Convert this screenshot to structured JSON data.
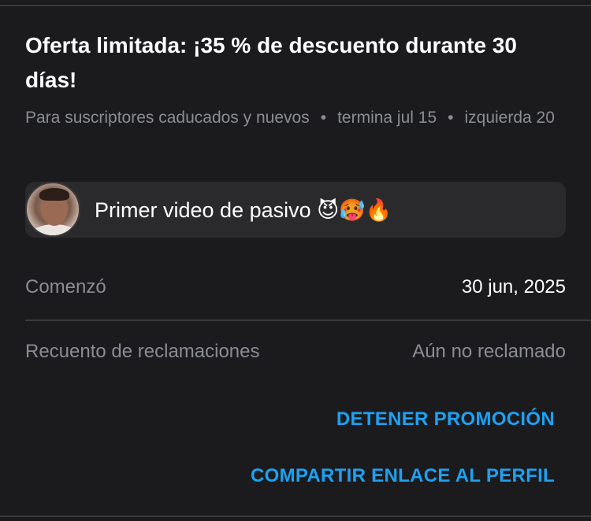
{
  "promo": {
    "title": "Oferta limitada: ¡35 % de descuento durante 30 días!",
    "audience": "Para suscriptores caducados y nuevos",
    "ends": "termina jul 15",
    "remaining": "izquierda 20",
    "separator": "•"
  },
  "message": {
    "text": "Primer video de pasivo 😈🥵🔥",
    "avatar_icon": "user-avatar"
  },
  "details": {
    "started_label": "Comenzó",
    "started_value": "30 jun, 2025",
    "claims_label": "Recuento de reclamaciones",
    "claims_value": "Aún no reclamado"
  },
  "actions": {
    "stop_label": "DETENER PROMOCIÓN",
    "share_label": "COMPARTIR ENLACE AL PERFIL"
  },
  "colors": {
    "background": "#1b1b1d",
    "muted_text": "#8a8d94",
    "accent": "#1da1f2",
    "card": "#2a2a2d"
  }
}
